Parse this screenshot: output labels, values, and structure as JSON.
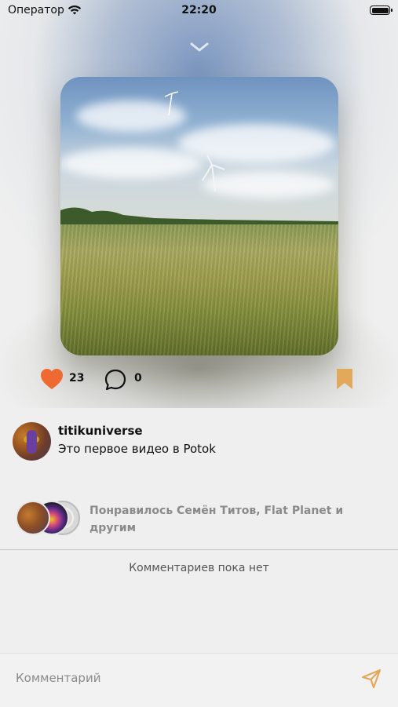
{
  "status_bar": {
    "carrier": "Оператор",
    "time": "22:20"
  },
  "post": {
    "likes": "23",
    "comments": "0",
    "author": "titikuniverse",
    "text": "Это первое видео в Potok"
  },
  "likes_summary": "Понравилось Семён Титов, Flat Planet и другим",
  "comments_empty": "Комментариев пока нет",
  "composer": {
    "placeholder": "Комментарий"
  },
  "colors": {
    "accent": "#ef6a33",
    "bookmark": "#e2a95a",
    "send": "#e2a95a"
  },
  "icons": [
    "wifi-icon",
    "battery-icon",
    "chevron-down-icon",
    "heart-icon",
    "comment-icon",
    "bookmark-icon",
    "send-icon"
  ]
}
